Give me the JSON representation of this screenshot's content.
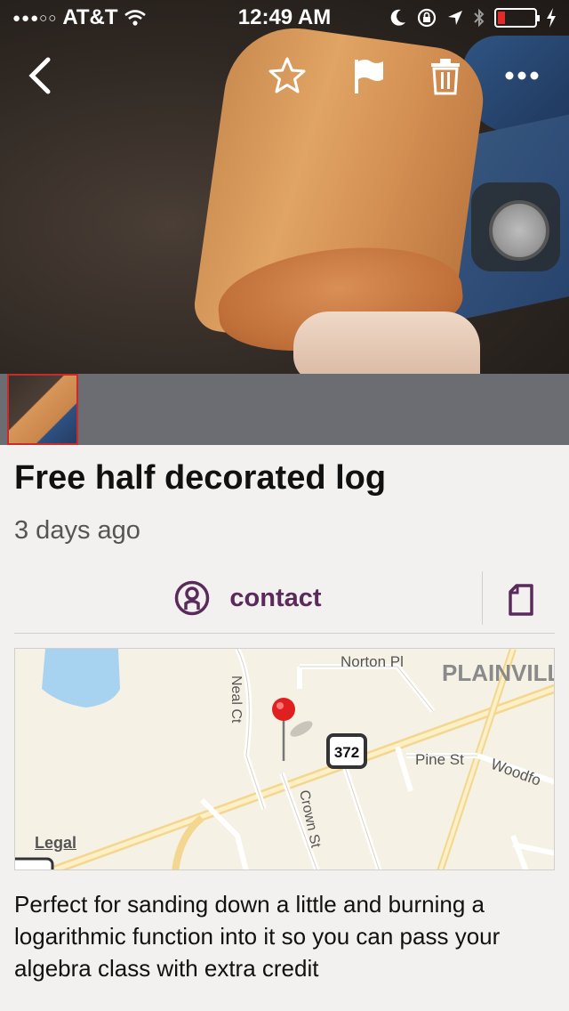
{
  "status_bar": {
    "carrier": "AT&T",
    "signal_dots": "●●●○○",
    "time": "12:49 AM"
  },
  "listing": {
    "title": "Free half decorated log",
    "age": "3 days ago",
    "contact_label": "contact",
    "description": "Perfect for sanding down a little and burning a logarithmic function into it so you can pass your algebra class with extra credit"
  },
  "map": {
    "labels": {
      "norton": "Norton Pl",
      "plainville": "PLAINVILL",
      "neal": "Neal Ct",
      "route": "372",
      "pine": "Pine St",
      "woodford": "Woodfo",
      "crown": "Crown St"
    },
    "legal": "Legal"
  },
  "colors": {
    "accent": "#5a2a5a",
    "strip": "#6b6d73",
    "thumb_border": "#c92a2a",
    "battery_low": "#e12b2b",
    "pin": "#e02020"
  }
}
